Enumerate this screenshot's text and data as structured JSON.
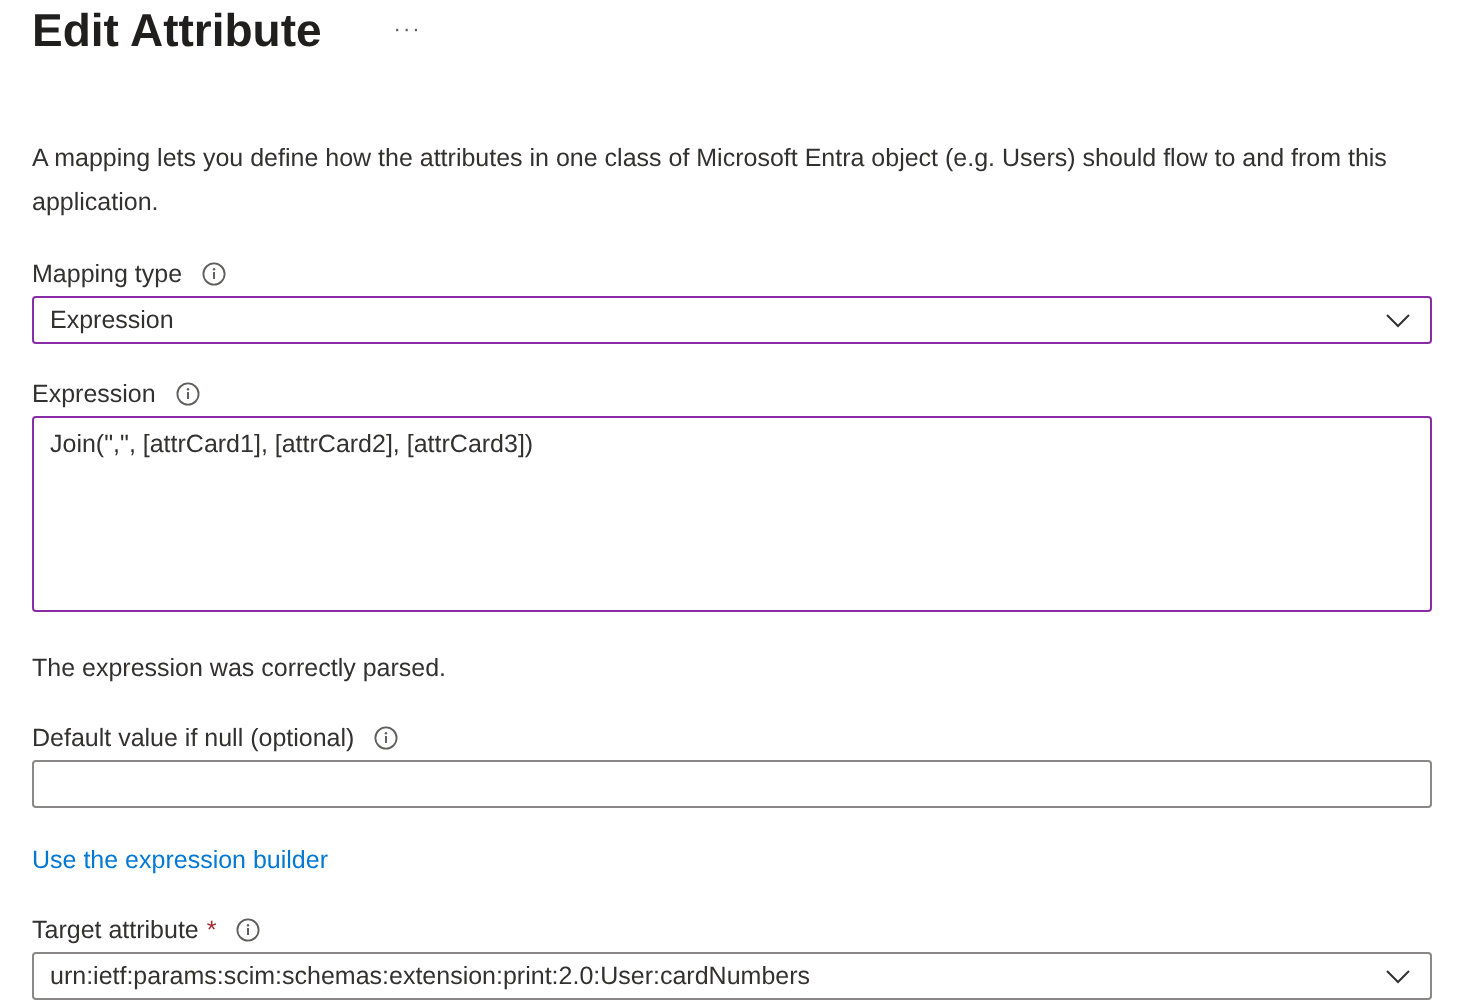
{
  "title": "Edit Attribute",
  "more_icon_text": "···",
  "description": "A mapping lets you define how the attributes in one class of Microsoft Entra object (e.g. Users) should flow to and from this application.",
  "items": [
    {
      "kind": "select",
      "label": "Mapping type",
      "value": "Expression",
      "highlighted": true
    },
    {
      "kind": "textarea",
      "label": "Expression",
      "value": "Join(\",\", [attrCard1], [attrCard2], [attrCard3])",
      "highlighted": true
    },
    {
      "kind": "note",
      "text": "The expression was correctly parsed."
    },
    {
      "kind": "text",
      "label": "Default value if null (optional)",
      "value": "",
      "highlighted": false
    },
    {
      "kind": "link",
      "text": "Use the expression builder"
    },
    {
      "kind": "select",
      "label": "Target attribute",
      "required_mark": "*",
      "value": "urn:ietf:params:scim:schemas:extension:print:2.0:User:cardNumbers",
      "highlighted": false
    }
  ]
}
